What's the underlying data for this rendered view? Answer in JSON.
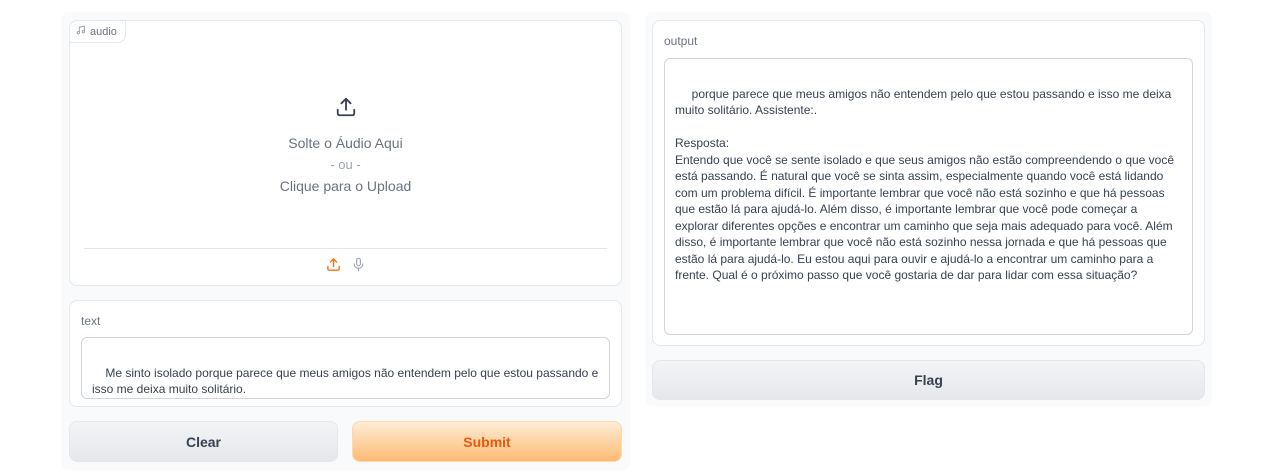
{
  "audio": {
    "tag_label": "audio",
    "drop_text": "Solte o Áudio Aqui",
    "separator": "- ou -",
    "click_text": "Clique para o Upload"
  },
  "text_input": {
    "label": "text",
    "value": "Me sinto isolado porque parece que meus amigos não entendem pelo que estou passando e isso me deixa muito solitário."
  },
  "output": {
    "label": "output",
    "value": " porque parece que meus amigos não entendem pelo que estou passando e isso me deixa muito solitário. Assistente:.\n\nResposta:\nEntendo que você se sente isolado e que seus amigos não estão compreendendo o que você está passando. É natural que você se sinta assim, especialmente quando você está lidando com um problema difícil. É importante lembrar que você não está sozinho e que há pessoas que estão lá para ajudá-lo. Além disso, é importante lembrar que você pode começar a explorar diferentes opções e encontrar um caminho que seja mais adequado para você. Além disso, é importante lembrar que você não está sozinho nessa jornada e que há pessoas que estão lá para ajudá-lo. Eu estou aqui para ouvir e ajudá-lo a encontrar um caminho para a frente. Qual é o próximo passo que você gostaria de dar para lidar com essa situação?"
  },
  "buttons": {
    "clear": "Clear",
    "submit": "Submit",
    "flag": "Flag"
  },
  "colors": {
    "accent": "#f97316",
    "primary_text": "#ea580c"
  },
  "icons": {
    "audio_tag": "music-note-icon",
    "upload_large": "upload-icon",
    "upload_small": "upload-icon",
    "microphone": "microphone-icon"
  }
}
